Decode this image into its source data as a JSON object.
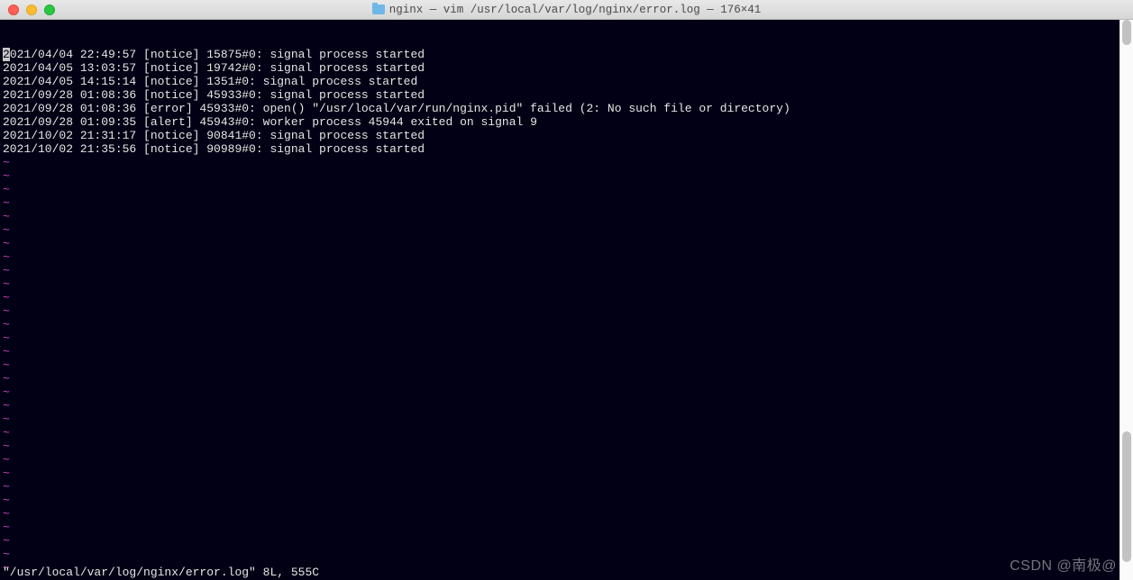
{
  "window": {
    "title": "nginx — vim /usr/local/var/log/nginx/error.log — 176×41"
  },
  "log_lines": [
    "2021/04/04 22:49:57 [notice] 15875#0: signal process started",
    "2021/04/05 13:03:57 [notice] 19742#0: signal process started",
    "2021/04/05 14:15:14 [notice] 1351#0: signal process started",
    "2021/09/28 01:08:36 [notice] 45933#0: signal process started",
    "2021/09/28 01:08:36 [error] 45933#0: open() \"/usr/local/var/run/nginx.pid\" failed (2: No such file or directory)",
    "2021/09/28 01:09:35 [alert] 45943#0: worker process 45944 exited on signal 9",
    "2021/10/02 21:31:17 [notice] 90841#0: signal process started",
    "2021/10/02 21:35:56 [notice] 90989#0: signal process started"
  ],
  "tilde": "~",
  "tilde_count": 31,
  "status_line": "\"/usr/local/var/log/nginx/error.log\" 8L, 555C",
  "watermark": "CSDN @南极@"
}
